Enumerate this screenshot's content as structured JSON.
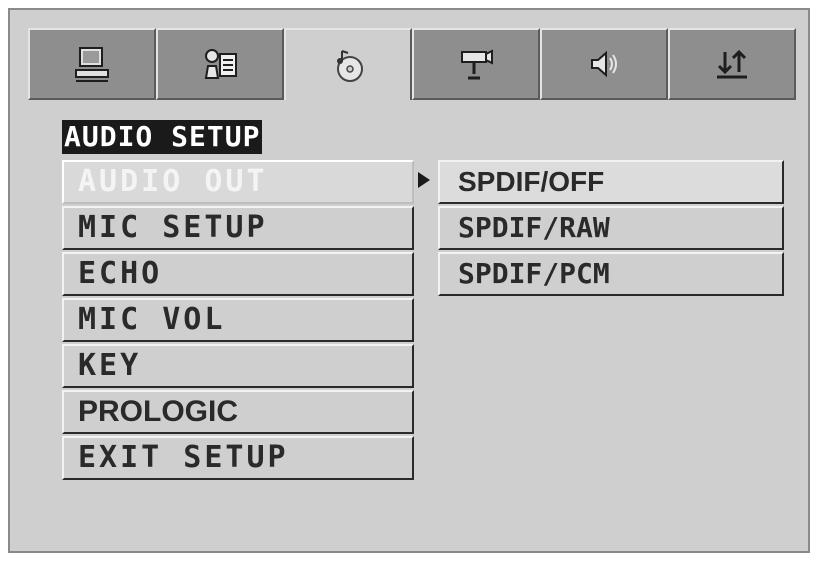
{
  "tabs": [
    {
      "icon": "monitor-icon"
    },
    {
      "icon": "language-icon"
    },
    {
      "icon": "audio-disc-icon",
      "active": true
    },
    {
      "icon": "video-camera-icon"
    },
    {
      "icon": "speaker-icon"
    },
    {
      "icon": "sort-arrows-icon"
    }
  ],
  "section_title": "AUDIO SETUP",
  "menu": {
    "items": [
      {
        "label": "AUDIO OUT",
        "selected": true
      },
      {
        "label": "MIC SETUP"
      },
      {
        "label": "ECHO"
      },
      {
        "label": "MIC VOL"
      },
      {
        "label": "KEY"
      },
      {
        "label": "PROLOGIC"
      },
      {
        "label": "EXIT SETUP"
      }
    ]
  },
  "submenu": {
    "items": [
      {
        "label": "SPDIF/OFF",
        "selected": true
      },
      {
        "label": "SPDIF/RAW"
      },
      {
        "label": "SPDIF/PCM"
      }
    ]
  },
  "colors": {
    "panel": "#cfcfcf",
    "tab_inactive": "#8e8e8e",
    "title_bg": "#1a1a1a",
    "text": "#2a2a2a"
  }
}
